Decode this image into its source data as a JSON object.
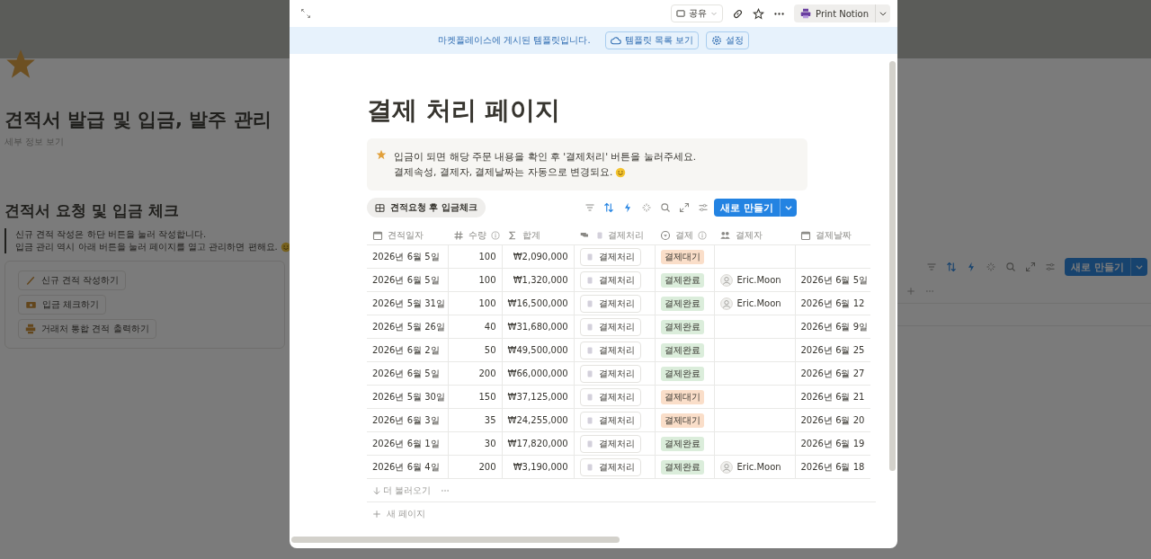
{
  "background_page": {
    "title": "견적서 발급 및 입금, 발주 관리",
    "subtitle": "세부 정보 보기",
    "section_heading": "견적서 요청 및 입금 체크",
    "quote": [
      "신규 견적 작성은 하단  버튼을 눌러 작성합니다.",
      "입금 관리 역시 아래 버튼을 눌러 페이지를 열고 관리하면 편해요."
    ],
    "buttons": [
      {
        "label": "신규 견적 작성하기",
        "kind": "pencil"
      },
      {
        "label": "입금 체크하기",
        "kind": "money"
      },
      {
        "label": "거래처 통합 견적 출력하기",
        "kind": "printer"
      }
    ],
    "new_button": "새로 만들기"
  },
  "modal": {
    "top_bar": {
      "share": "공유",
      "print_button": "Print Notion"
    },
    "banner": {
      "text": "마켓플레이스에 게시된 템플릿입니다.",
      "buttons": [
        {
          "label": "템플릿 목록 보기",
          "kind": "templates"
        },
        {
          "label": "설정",
          "kind": "settings"
        }
      ]
    },
    "title": "결제 처리 페이지",
    "callout": [
      "입금이 되면 해당 주문 내용을 확인 후 '결제처리' 버튼을 눌러주세요.",
      "결제속성, 결제자, 결제날짜는 자동으로 변경되요."
    ],
    "view_tab": "견적요청 후 입금체크",
    "new_button": "새로 만들기",
    "table": {
      "columns": [
        {
          "label": "견적일자",
          "kind": "date"
        },
        {
          "label": "수량",
          "kind": "number"
        },
        {
          "label": "합계",
          "kind": "formula"
        },
        {
          "label": "결제처리",
          "kind": "button"
        },
        {
          "label": "결제",
          "kind": "status"
        },
        {
          "label": "결제자",
          "kind": "person"
        },
        {
          "label": "결제날짜",
          "kind": "date"
        }
      ],
      "rows": [
        {
          "date": "2026년 6월 5일",
          "qty": "100",
          "total": "₩2,090,000",
          "action": "결제처리",
          "status": {
            "label": "결제대기",
            "color": "#fadec9"
          }
        },
        {
          "date": "2026년 6월 5일",
          "qty": "100",
          "total": "₩1,320,000",
          "action": "결제처리",
          "status": {
            "label": "결제완료",
            "color": "#dbeddb"
          },
          "payer": "Eric.Moon",
          "paid_date": "2026년 6월 5일"
        },
        {
          "date": "2026년 5월 31일",
          "qty": "100",
          "total": "₩16,500,000",
          "action": "결제처리",
          "status": {
            "label": "결제완료",
            "color": "#dbeddb"
          },
          "payer": "Eric.Moon",
          "paid_date": "2026년 6월 12"
        },
        {
          "date": "2026년 5월 26일",
          "qty": "40",
          "total": "₩31,680,000",
          "action": "결제처리",
          "status": {
            "label": "결제완료",
            "color": "#dbeddb"
          },
          "paid_date": "2026년 6월 9일"
        },
        {
          "date": "2026년 6월 2일",
          "qty": "50",
          "total": "₩49,500,000",
          "action": "결제처리",
          "status": {
            "label": "결제완료",
            "color": "#dbeddb"
          },
          "paid_date": "2026년 6월 25"
        },
        {
          "date": "2026년 6월 5일",
          "qty": "200",
          "total": "₩66,000,000",
          "action": "결제처리",
          "status": {
            "label": "결제완료",
            "color": "#dbeddb"
          },
          "paid_date": "2026년 6월 27"
        },
        {
          "date": "2026년 5월 30일",
          "qty": "150",
          "total": "₩37,125,000",
          "action": "결제처리",
          "status": {
            "label": "결제대기",
            "color": "#fadec9"
          },
          "paid_date": "2026년 6월 21"
        },
        {
          "date": "2026년 6월 3일",
          "qty": "35",
          "total": "₩24,255,000",
          "action": "결제처리",
          "status": {
            "label": "결제대기",
            "color": "#fadec9"
          },
          "paid_date": "2026년 6월 20"
        },
        {
          "date": "2026년 6월 1일",
          "qty": "30",
          "total": "₩17,820,000",
          "action": "결제처리",
          "status": {
            "label": "결제완료",
            "color": "#dbeddb"
          },
          "paid_date": "2026년 6월 19"
        },
        {
          "date": "2026년 6월 4일",
          "qty": "200",
          "total": "₩3,190,000",
          "action": "결제처리",
          "status": {
            "label": "결제완료",
            "color": "#dbeddb"
          },
          "payer": "Eric.Moon",
          "paid_date": "2026년 6월 18"
        }
      ]
    },
    "load_more": "더 불러오기",
    "new_page": "새 페이지"
  }
}
